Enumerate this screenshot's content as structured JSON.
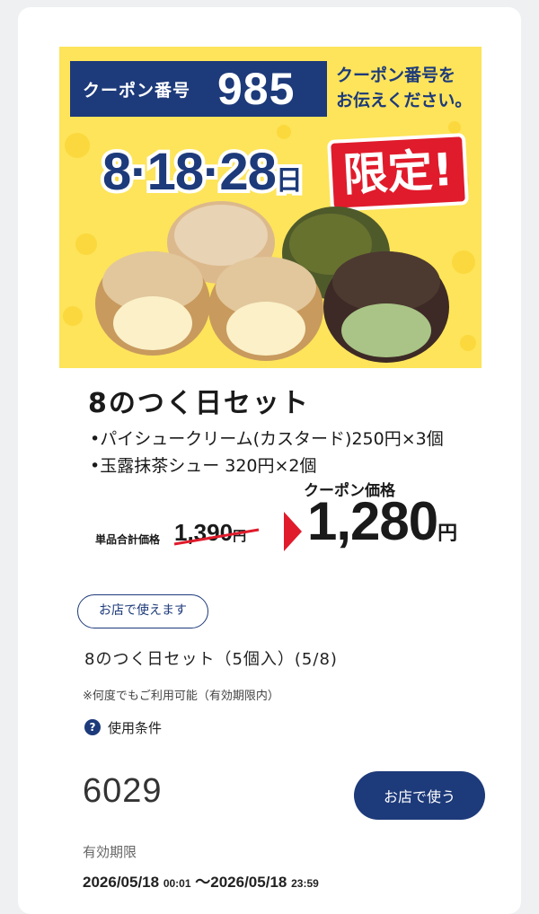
{
  "banner": {
    "coupon_label": "クーポン番号",
    "coupon_number": "985",
    "notify_line1": "クーポン番号を",
    "notify_line2": "お伝えください。",
    "dates": "8·18·28",
    "dates_suffix": "日",
    "limited": "限定!"
  },
  "product": {
    "title": "8のつく日セット",
    "items": [
      "•パイシュークリーム(カスタード)250円×3個",
      "•玉露抹茶シュー 320円×2個"
    ],
    "coupon_price_label": "クーポン価格",
    "sum_label": "単品合計価格",
    "old_price": "1,390",
    "new_price": "1,280",
    "yen": "円"
  },
  "details": {
    "store_tag": "お店で使えます",
    "name": "8のつく日セット（5個入）(5/8)",
    "note": "※何度でもご利用可能（有効期限内）",
    "terms_icon": "question-icon",
    "terms_label": "使用条件",
    "code": "6029",
    "use_button": "お店で使う",
    "valid_label": "有効期限",
    "valid_start_date": "2026/05/18",
    "valid_start_time": "00:01",
    "valid_sep": "～",
    "valid_end_date": "2026/05/18",
    "valid_end_time": "23:59"
  },
  "colors": {
    "navy": "#1d3a7a",
    "banner_yellow": "#fde45a",
    "accent_red": "#e01b2b"
  }
}
